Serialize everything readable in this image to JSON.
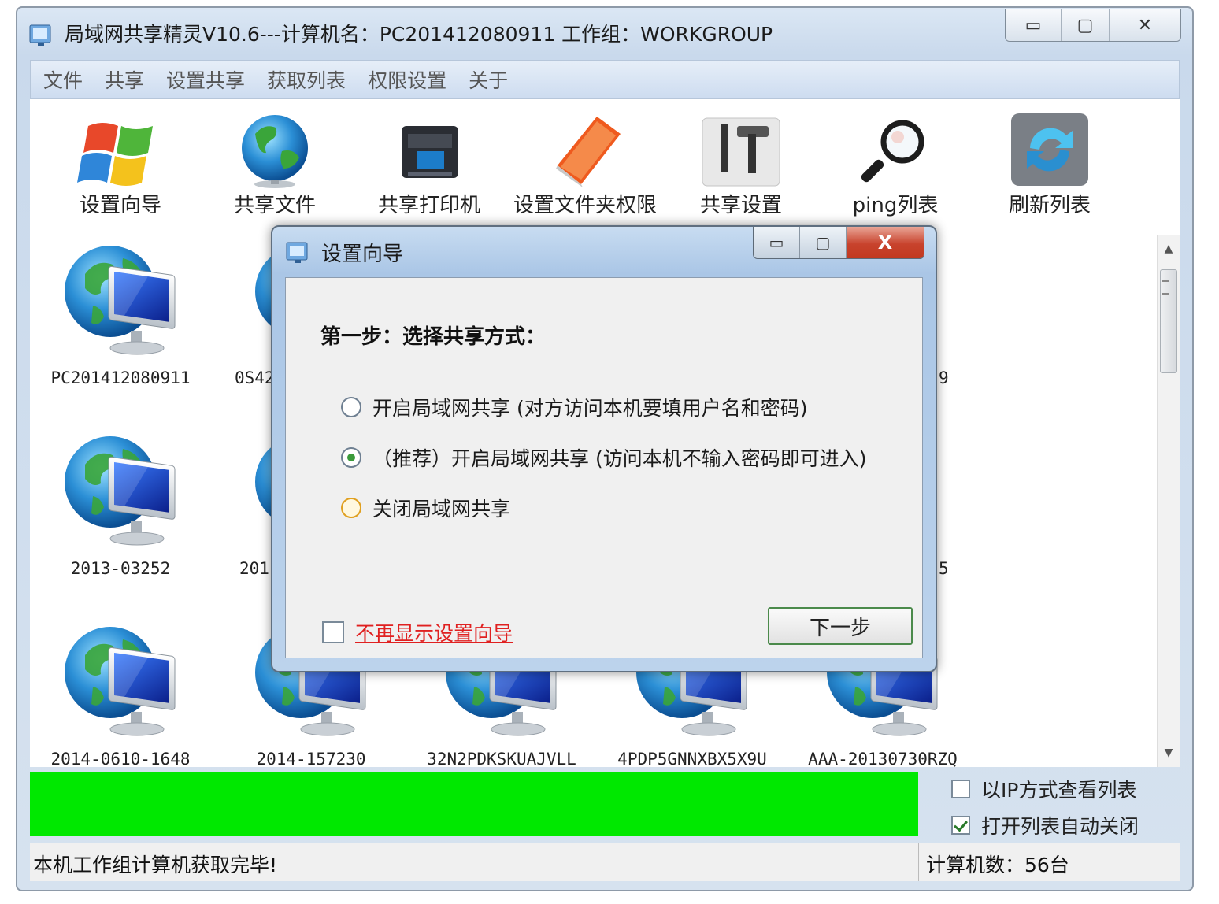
{
  "window": {
    "title": "局域网共享精灵V10.6---计算机名：PC201412080911  工作组：WORKGROUP",
    "minimize": "▭",
    "maximize": "▢",
    "close": "✕"
  },
  "menu": [
    "文件",
    "共享",
    "设置共享",
    "获取列表",
    "权限设置",
    "关于"
  ],
  "toolbar": [
    {
      "label": "设置向导",
      "icon": "windows-logo-icon"
    },
    {
      "label": "共享文件",
      "icon": "globe-icon"
    },
    {
      "label": "共享打印机",
      "icon": "printer-icon"
    },
    {
      "label": "设置文件夹权限",
      "icon": "folder-book-icon"
    },
    {
      "label": "共享设置",
      "icon": "tools-icon"
    },
    {
      "label": "ping列表",
      "icon": "magnifier-icon"
    },
    {
      "label": "刷新列表",
      "icon": "refresh-icon"
    }
  ],
  "computers": [
    "PC201412080911",
    "0S42",
    "9",
    "2013-03252",
    "201",
    "5",
    "2014-0610-1648",
    "2014-157230",
    "32N2PDKSKUAJVLL",
    "4PDP5GNNXBX5X9U",
    "AAA-20130730RZQ"
  ],
  "options": {
    "view_by_ip": "以IP方式查看列表",
    "auto_close": "打开列表自动关闭"
  },
  "status": {
    "message": "本机工作组计算机获取完毕!",
    "count": "计算机数：56台"
  },
  "dialog": {
    "title": "设置向导",
    "step": "第一步：选择共享方式：",
    "radios": [
      "开启局域网共享 (对方访问本机要填用户名和密码)",
      "（推荐）开启局域网共享 (访问本机不输入密码即可进入)",
      "关闭局域网共享"
    ],
    "dont_show": "不再显示设置向导",
    "next": "下一步",
    "min": "▭",
    "max": "▢",
    "close": "X"
  },
  "colors": {
    "progress": "#00e800",
    "dont_show_text": "#e02020"
  }
}
